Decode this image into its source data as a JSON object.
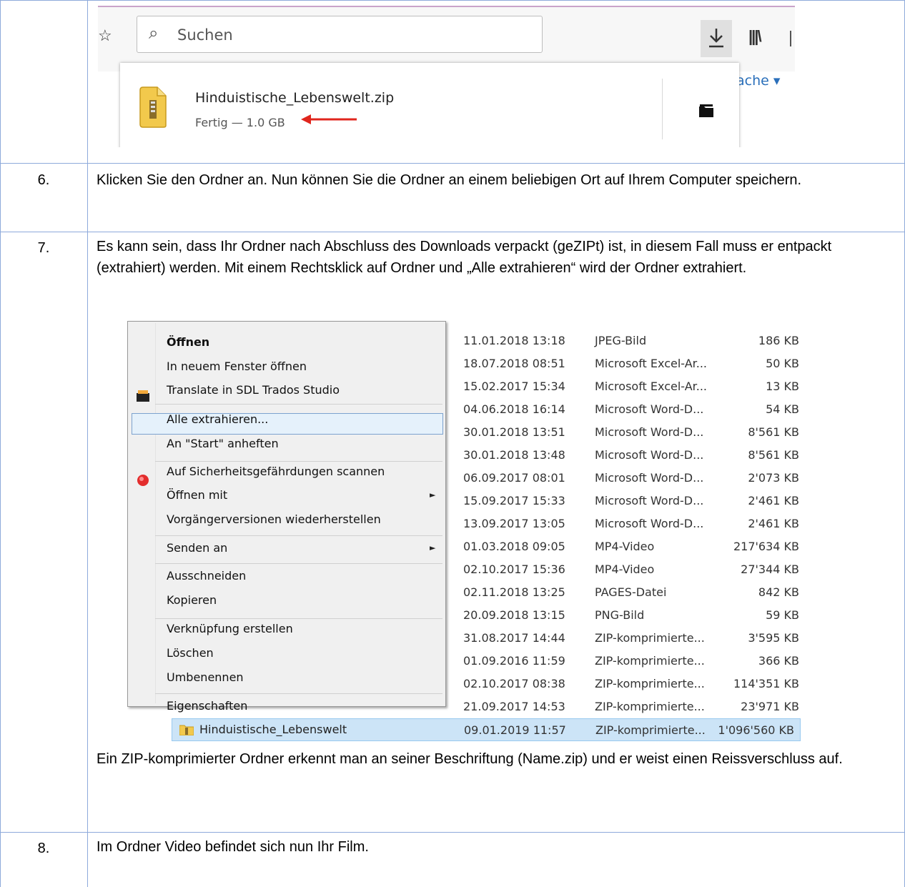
{
  "browser": {
    "search_placeholder": "Suchen",
    "partial_link": "ache ▾",
    "download": {
      "filename": "Hinduistische_Lebenswelt.zip",
      "status": "Fertig — 1.0 GB"
    }
  },
  "steps": [
    {
      "number": "6.",
      "text": "Klicken Sie den Ordner an. Nun können Sie die Ordner an einem beliebigen Ort auf Ihrem Computer speichern."
    },
    {
      "number": "7.",
      "text": "Es kann sein, dass Ihr Ordner nach Abschluss des Downloads verpackt (geZIPt) ist, in diesem Fall muss er entpackt (extrahiert) werden. Mit einem Rechtsklick auf Ordner und „Alle extrahieren“ wird der Ordner extrahiert.",
      "note": "Ein ZIP-komprimierter Ordner erkennt man an seiner Beschriftung (Name.zip) und er weist einen Reissverschluss auf."
    },
    {
      "number": "8.",
      "text": "Im Ordner Video befindet sich nun Ihr Film."
    }
  ],
  "context_menu": {
    "items": [
      "Öffnen",
      "In neuem Fenster öffnen",
      "Translate in SDL Trados Studio",
      "Alle extrahieren...",
      "An \"Start\" anheften",
      "Auf Sicherheitsgefährdungen scannen",
      "Öffnen mit",
      "Vorgängerversionen wiederherstellen",
      "Senden an",
      "Ausschneiden",
      "Kopieren",
      "Verknüpfung erstellen",
      "Löschen",
      "Umbenennen",
      "Eigenschaften"
    ],
    "submenu_arrow": "►"
  },
  "files": [
    {
      "date": "11.01.2018 13:18",
      "type": "JPEG-Bild",
      "size": "186 KB"
    },
    {
      "date": "18.07.2018 08:51",
      "type": "Microsoft Excel-Ar...",
      "size": "50 KB"
    },
    {
      "date": "15.02.2017 15:34",
      "type": "Microsoft Excel-Ar...",
      "size": "13 KB"
    },
    {
      "date": "04.06.2018 16:14",
      "type": "Microsoft Word-D...",
      "size": "54 KB"
    },
    {
      "date": "30.01.2018 13:51",
      "type": "Microsoft Word-D...",
      "size": "8'561 KB"
    },
    {
      "date": "30.01.2018 13:48",
      "type": "Microsoft Word-D...",
      "size": "8'561 KB"
    },
    {
      "date": "06.09.2017 08:01",
      "type": "Microsoft Word-D...",
      "size": "2'073 KB"
    },
    {
      "date": "15.09.2017 15:33",
      "type": "Microsoft Word-D...",
      "size": "2'461 KB"
    },
    {
      "date": "13.09.2017 13:05",
      "type": "Microsoft Word-D...",
      "size": "2'461 KB"
    },
    {
      "date": "01.03.2018 09:05",
      "type": "MP4-Video",
      "size": "217'634 KB"
    },
    {
      "date": "02.10.2017 15:36",
      "type": "MP4-Video",
      "size": "27'344 KB"
    },
    {
      "date": "02.11.2018 13:25",
      "type": "PAGES-Datei",
      "size": "842 KB"
    },
    {
      "date": "20.09.2018 13:15",
      "type": "PNG-Bild",
      "size": "59 KB"
    },
    {
      "date": "31.08.2017 14:44",
      "type": "ZIP-komprimierte...",
      "size": "3'595 KB"
    },
    {
      "date": "01.09.2016 11:59",
      "type": "ZIP-komprimierte...",
      "size": "366 KB"
    },
    {
      "date": "02.10.2017 08:38",
      "type": "ZIP-komprimierte...",
      "size": "114'351 KB"
    },
    {
      "date": "21.09.2017 14:53",
      "type": "ZIP-komprimierte...",
      "size": "23'971 KB"
    }
  ],
  "selected_file": {
    "name": "Hinduistische_Lebenswelt",
    "date": "09.01.2019 11:57",
    "type": "ZIP-komprimierte...",
    "size": "1'096'560 KB"
  }
}
